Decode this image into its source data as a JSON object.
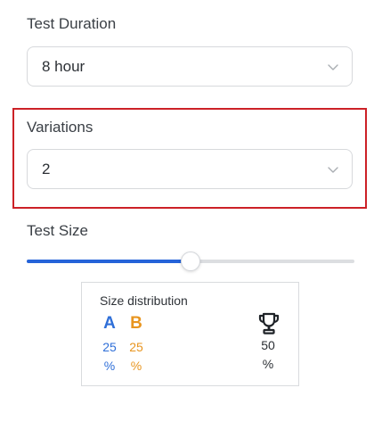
{
  "duration": {
    "label": "Test Duration",
    "value": "8 hour"
  },
  "variations": {
    "label": "Variations",
    "value": "2"
  },
  "test_size": {
    "label": "Test Size",
    "slider_fraction": 0.5
  },
  "distribution": {
    "title": "Size distribution",
    "a": {
      "letter": "A",
      "value": "25",
      "unit": "%"
    },
    "b": {
      "letter": "B",
      "value": "25",
      "unit": "%"
    },
    "winner": {
      "value": "50",
      "unit": "%"
    }
  },
  "colors": {
    "highlight": "#cc2127",
    "slider_fill": "#2563d9",
    "variant_a": "#2f6fd8",
    "variant_b": "#e8951f"
  },
  "icons": {
    "dropdown": "chevron-down-icon",
    "winner": "trophy-icon"
  }
}
